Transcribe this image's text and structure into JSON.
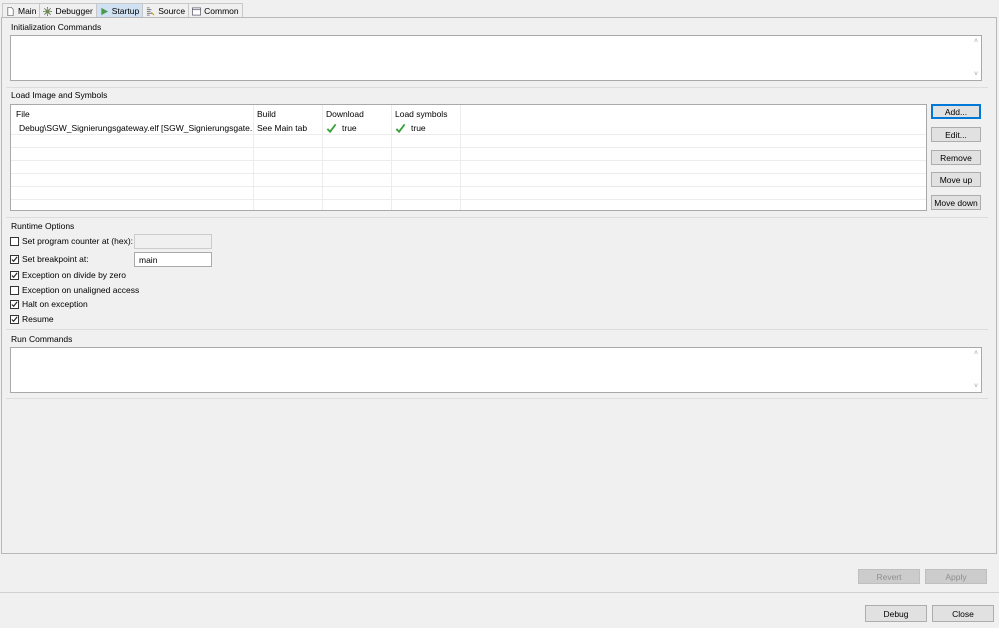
{
  "tabs": [
    {
      "label": "Main",
      "icon": "document-icon",
      "active": false
    },
    {
      "label": "Debugger",
      "icon": "debugger-icon",
      "active": false
    },
    {
      "label": "Startup",
      "icon": "play-icon",
      "active": true
    },
    {
      "label": "Source",
      "icon": "source-icon",
      "active": false
    },
    {
      "label": "Common",
      "icon": "common-icon",
      "active": false
    }
  ],
  "init_commands": {
    "label": "Initialization Commands",
    "value": ""
  },
  "load_image": {
    "label": "Load Image and Symbols",
    "columns": [
      "File",
      "Build",
      "Download",
      "Load symbols"
    ],
    "rows": [
      {
        "file": "Debug\\SGW_Signierungsgateway.elf [SGW_Signierungsgate...",
        "build": "See Main tab",
        "download": "true",
        "load_symbols": "true"
      }
    ],
    "buttons": [
      "Add...",
      "Edit...",
      "Remove",
      "Move up",
      "Move down"
    ]
  },
  "runtime": {
    "label": "Runtime Options",
    "set_pc_label": "Set program counter at (hex):",
    "set_pc_checked": false,
    "set_pc_value": "",
    "set_bp_label": "Set breakpoint at:",
    "set_bp_checked": true,
    "set_bp_value": "main",
    "options": [
      {
        "label": "Exception on divide by zero",
        "checked": true
      },
      {
        "label": "Exception on unaligned access",
        "checked": false
      },
      {
        "label": "Halt on exception",
        "checked": true
      },
      {
        "label": "Resume",
        "checked": true
      }
    ]
  },
  "run_commands": {
    "label": "Run Commands",
    "value": ""
  },
  "footer": {
    "revert": "Revert",
    "apply": "Apply"
  },
  "dialog": {
    "debug": "Debug",
    "close": "Close"
  },
  "colors": {
    "active_tab": "#cfe1f3",
    "check_green": "#3aa13a",
    "focus_blue": "#0078d7"
  }
}
